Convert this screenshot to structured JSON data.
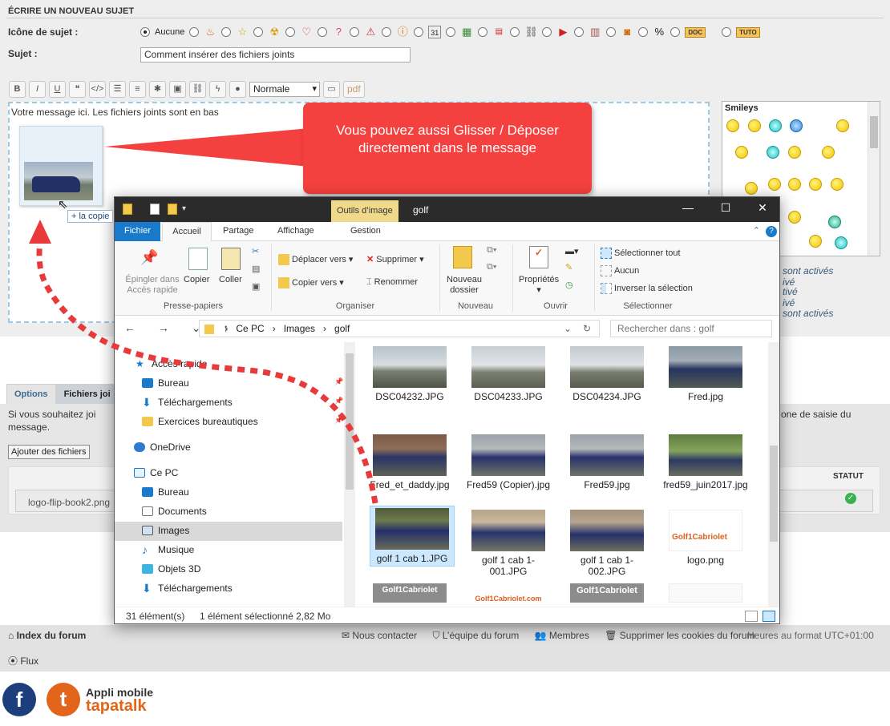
{
  "editor_page": {
    "section_title": "ÉCRIRE UN NOUVEAU SUJET",
    "icon_label": "Icône de sujet :",
    "icon_none": "Aucune",
    "icon_doc_tag": "DOC",
    "icon_tuto_tag": "TUTO",
    "subject_label": "Sujet :",
    "subject_value": "Comment insérer des fichiers joints",
    "toolbar": {
      "bold": "B",
      "italic": "I",
      "underline": "U",
      "size_select": "Normale",
      "pdf_label": "pdf"
    },
    "editor_text": "Votre message ici. Les fichiers joints sont en bas",
    "copy_badge": "+ la copie",
    "smileys_title": "Smileys",
    "side_info": [
      "sont activés",
      "ivé",
      "tivé",
      "ivé",
      "sont activés"
    ],
    "tabs": [
      "Options",
      "Fichiers joi"
    ],
    "attach_text1": "Si vous souhaitez joi",
    "attach_text2": "message.",
    "attach_text_right": "one de saisie du",
    "add_files_button": "Ajouter des fichiers",
    "status_header": "STATUT",
    "attached_file": "logo-flip-book2.png",
    "footer": {
      "index": "Index du forum",
      "contact": "Nous contacter",
      "team": "L’équipe du forum",
      "members": "Membres",
      "cookies": "Supprimer les cookies du forum",
      "timezone": "Heures au format UTC+01:00",
      "flux": "Flux"
    },
    "app_label1": "Appli mobile",
    "app_label2": "tapatalk"
  },
  "callout": {
    "text": "Vous pouvez aussi Glisser / Déposer directement dans le message",
    "color": "#f4403f"
  },
  "explorer": {
    "context_tab": "Outils d’image",
    "title": "golf",
    "ribbon_tabs": [
      "Fichier",
      "Accueil",
      "Partage",
      "Affichage",
      "Gestion"
    ],
    "clipboard": {
      "pin": "Épingler dans Accès rapide",
      "copy": "Copier",
      "paste": "Coller",
      "label": "Presse-papiers"
    },
    "organize": {
      "move": "Déplacer vers",
      "copy_to": "Copier vers",
      "delete": "Supprimer",
      "rename": "Renommer",
      "label": "Organiser"
    },
    "new_group": {
      "new_folder": "Nouveau dossier",
      "label": "Nouveau"
    },
    "open_group": {
      "properties": "Propriétés",
      "label": "Ouvrir"
    },
    "select_group": {
      "select_all": "Sélectionner tout",
      "none": "Aucun",
      "invert": "Inverser la sélection",
      "label": "Sélectionner"
    },
    "path": [
      "Ce PC",
      "Images",
      "golf"
    ],
    "search_placeholder": "Rechercher dans : golf",
    "nav": [
      "Accès rapide",
      "Bureau",
      "Téléchargements",
      "Exercices bureautiques",
      "OneDrive",
      "Ce PC",
      "Bureau",
      "Documents",
      "Images",
      "Musique",
      "Objets 3D",
      "Téléchargements"
    ],
    "files": [
      "DSC04232.JPG",
      "DSC04233.JPG",
      "DSC04234.JPG",
      "Fred.jpg",
      "Fred_et_daddy.jpg",
      "Fred59 (Copier).jpg",
      "Fred59.jpg",
      "fred59_juin2017.jpg",
      "golf 1 cab 1.JPG",
      "golf 1 cab 1-001.JPG",
      "golf 1 cab 1-002.JPG",
      "logo.png"
    ],
    "logo_tiles": [
      "Golf1Cabriolet",
      "Golf1Cabriolet.com",
      "Golf1Cabriolet",
      "Golf1Cabriolet"
    ],
    "status_count": "31 élément(s)",
    "status_selected": "1 élément sélectionné  2,82 Mo",
    "accent": "#1979ca"
  }
}
